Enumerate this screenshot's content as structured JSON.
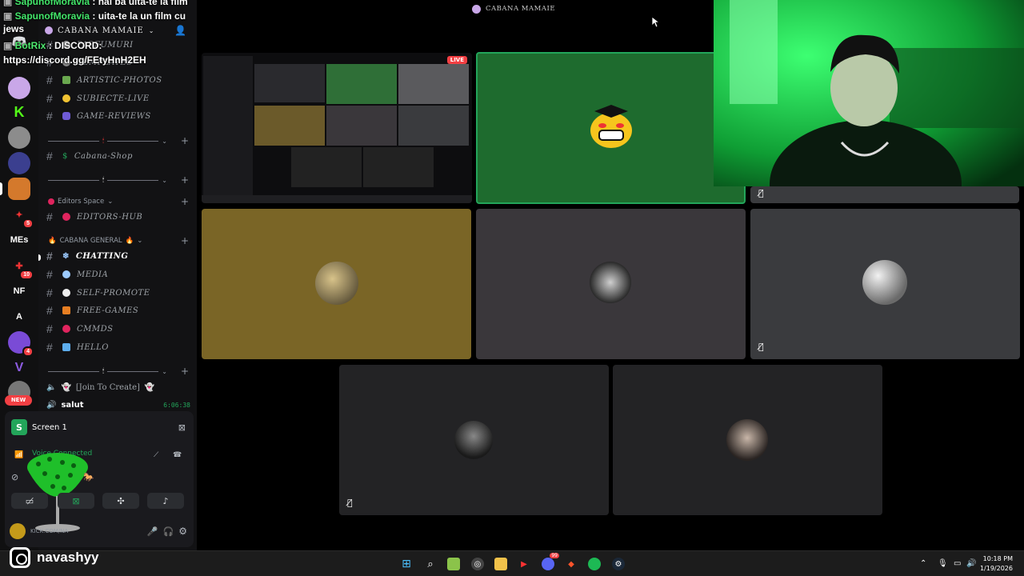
{
  "chat": [
    {
      "user": "SapunofMoravia",
      "text": ": hai ba uita-te la film"
    },
    {
      "user": "SapunofMoravia",
      "text": ": uita-te la un film cu"
    },
    {
      "cont": "jews"
    },
    {
      "user": "BotRix",
      "text": ": DISCORD:"
    },
    {
      "cont": "https://discord.gg/FEtyHnH2EH"
    }
  ],
  "server": {
    "name": "CABANA MAMAIE"
  },
  "channels_top": [
    "PARFUMURI",
    "TEMPLATES",
    "ARTISTIC-PHOTOS",
    "SUBIECTE-LIVE",
    "GAME-REVIEWS"
  ],
  "shop_channel": "Cabana-Shop",
  "categories": {
    "editors": "Editors Space",
    "general": "CABANA GENERAL"
  },
  "editors_channel": "EDITORS-HUB",
  "general_channels": [
    "CHATTING",
    "MEDIA",
    "SELF-PROMOTE",
    "FREE-GAMES",
    "CMMDS",
    "HELLO"
  ],
  "voice_channel": "[Join To Create]",
  "voice_user": {
    "name": "salut",
    "time": "6:06:38"
  },
  "screen_label": "Screen 1",
  "voice_status": "Voice Connected",
  "user_status": "KICK.COM/NA",
  "rail_labels": {
    "mes": "MEs",
    "nf": "NF",
    "a": "A",
    "new": "NEW"
  },
  "rail_badges": {
    "b1": "5",
    "b2": "10",
    "b3": "4"
  },
  "stage": {
    "title": "CABANA MAMAIE",
    "live": "LIVE"
  },
  "instagram": "navashyy",
  "clock": {
    "time": "10:18 PM",
    "date": "1/19/2026"
  },
  "taskbar_badge": "99"
}
